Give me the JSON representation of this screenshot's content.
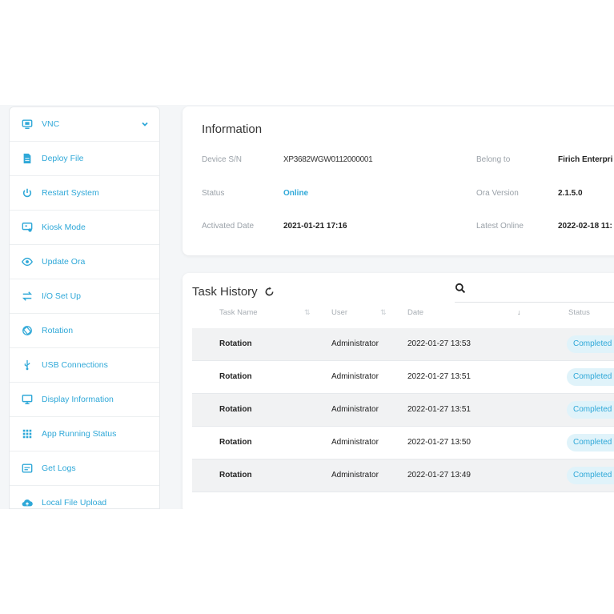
{
  "colors": {
    "accent": "#2fa8d8",
    "badge_bg": "#e0f3fa"
  },
  "sidebar": {
    "items": [
      {
        "label": "VNC",
        "icon": "monitor-icon",
        "expanded": true
      },
      {
        "label": "Deploy File",
        "icon": "file-icon"
      },
      {
        "label": "Restart System",
        "icon": "power-icon"
      },
      {
        "label": "Kiosk Mode",
        "icon": "kiosk-icon"
      },
      {
        "label": "Update Ora",
        "icon": "eye-icon"
      },
      {
        "label": "I/O Set Up",
        "icon": "swap-arrows-icon"
      },
      {
        "label": "Rotation",
        "icon": "rotation-icon"
      },
      {
        "label": "USB Connections",
        "icon": "usb-icon"
      },
      {
        "label": "Display Information",
        "icon": "display-icon"
      },
      {
        "label": "App Running Status",
        "icon": "grid-icon"
      },
      {
        "label": "Get Logs",
        "icon": "logs-icon"
      },
      {
        "label": "Local File Upload",
        "icon": "cloud-upload-icon"
      }
    ]
  },
  "information": {
    "title": "Information",
    "device_sn_label": "Device S/N",
    "device_sn_value": "XP3682WGW0112000001",
    "status_label": "Status",
    "status_value": "Online",
    "activated_label": "Activated Date",
    "activated_value": "2021-01-21 17:16",
    "belong_label": "Belong to",
    "belong_value": "Firich Enterpri",
    "version_label": "Ora Version",
    "version_value": "2.1.5.0",
    "latest_label": "Latest Online",
    "latest_value": "2022-02-18 11:"
  },
  "task_history": {
    "title": "Task History",
    "columns": {
      "task_name": "Task Name",
      "user": "User",
      "date": "Date",
      "status": "Status"
    },
    "rows": [
      {
        "task": "Rotation",
        "user": "Administrator",
        "date": "2022-01-27 13:53",
        "status": "Completed"
      },
      {
        "task": "Rotation",
        "user": "Administrator",
        "date": "2022-01-27 13:51",
        "status": "Completed"
      },
      {
        "task": "Rotation",
        "user": "Administrator",
        "date": "2022-01-27 13:51",
        "status": "Completed"
      },
      {
        "task": "Rotation",
        "user": "Administrator",
        "date": "2022-01-27 13:50",
        "status": "Completed"
      },
      {
        "task": "Rotation",
        "user": "Administrator",
        "date": "2022-01-27 13:49",
        "status": "Completed"
      }
    ]
  }
}
